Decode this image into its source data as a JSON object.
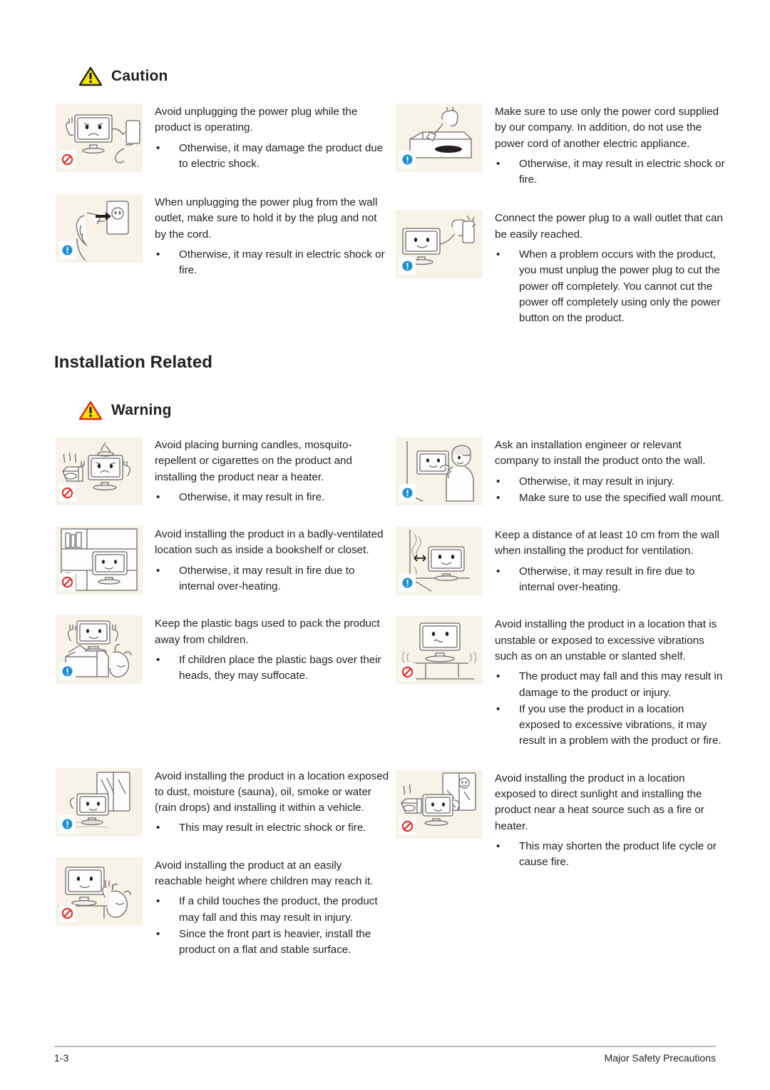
{
  "page": {
    "footer_page_number": "1-3",
    "footer_chapter": "Major Safety Precautions"
  },
  "colors": {
    "caution_triangle_fill": "#f7e400",
    "caution_triangle_stroke": "#231f20",
    "warning_triangle_fill": "#f7e400",
    "warning_triangle_stroke": "#e2231a",
    "prohibition_icon": "#e2231a",
    "info_icon": "#1b8fd1",
    "thumb_background": "#f7f3e8",
    "footer_rule": "#b9bec4",
    "text": "#231f20"
  },
  "sections": [
    {
      "id": "caution-section",
      "header": {
        "label": "Caution",
        "icon": "warning-triangle-icon"
      },
      "items_left": [
        {
          "illustration": "monitor-angry-unplugging-power-plug-illustration",
          "badge": "prohibition-icon",
          "lead": "Avoid unplugging the power plug while the product is operating.",
          "bullets": [
            "Otherwise, it may damage the product due to electric shock."
          ]
        },
        {
          "illustration": "hand-pulling-plug-from-wall-outlet-illustration",
          "badge": "info-icon",
          "lead": "When unplugging the power plug from the wall outlet, make sure to hold it by the plug and not by the cord.",
          "bullets": [
            "Otherwise, it may result in electric shock or fire."
          ]
        }
      ],
      "items_right": [
        {
          "illustration": "power-cord-in-samsung-box-illustration",
          "badge": "info-icon",
          "lead": "Make sure to use only the power cord supplied by our company. In addition, do not use the power cord of another electric appliance.",
          "bullets": [
            "Otherwise, it may result in electric shock or fire."
          ]
        },
        {
          "illustration": "monitor-plugged-into-wall-outlet-illustration",
          "badge": "info-icon",
          "lead": "Connect the power plug to a wall outlet that can be easily reached.",
          "bullets": [
            "When a problem occurs with the product, you must unplug the power plug to cut the power off completely. You cannot cut the power off completely using only the power button on the product."
          ]
        }
      ]
    },
    {
      "id": "installation-related-section",
      "title": "Installation Related",
      "header": {
        "label": "Warning",
        "icon": "warning-triangle-icon"
      },
      "items_left": [
        {
          "illustration": "monitor-near-candle-and-heater-illustration",
          "badge": "prohibition-icon",
          "lead": "Avoid placing burning candles,  mosquito-repellent or cigarettes on the product and installing the product near a heater.",
          "bullets": [
            "Otherwise, it may result in fire."
          ]
        },
        {
          "illustration": "monitor-inside-bookshelf-illustration",
          "badge": "prohibition-icon",
          "lead": "Avoid installing the product in a badly-ventilated location such as inside a bookshelf or closet.",
          "bullets": [
            "Otherwise, it may result in fire due to internal over-heating."
          ]
        },
        {
          "illustration": "child-with-plastic-bags-illustration",
          "badge": "info-icon",
          "lead": "Keep the plastic bags used to pack the product away from children.",
          "bullets": [
            " If children place the plastic bags over their heads, they may suffocate."
          ]
        },
        {
          "illustration": "monitor-exposed-to-rain-and-dust-illustration",
          "badge": "info-icon",
          "lead": "Avoid installing the product in a location exposed to dust, moisture (sauna), oil, smoke or water (rain drops) and installing it within a vehicle.",
          "bullets": [
            "This may result in electric shock or fire."
          ]
        },
        {
          "illustration": "child-reaching-for-monitor-illustration",
          "badge": "prohibition-icon",
          "lead": "Avoid installing the product at an easily reachable height where children may reach it.",
          "bullets": [
            "If a child touches the product, the product may fall and this may result in injury.",
            "Since the front part is heavier, install the product on a flat and stable surface."
          ]
        }
      ],
      "items_right": [
        {
          "illustration": "engineer-installing-monitor-on-wall-illustration",
          "badge": "info-icon",
          "lead": "Ask an installation engineer or relevant company to install the product onto the wall.",
          "bullets": [
            "Otherwise, it may result in injury.",
            "Make sure to use the specified wall mount."
          ]
        },
        {
          "illustration": "monitor-distance-from-wall-illustration",
          "badge": "info-icon",
          "lead": "Keep a distance of at least 10 cm from the wall when installing the product for ventilation.",
          "bullets": [
            "Otherwise, it may result in fire due to internal over-heating."
          ]
        },
        {
          "illustration": "monitor-on-unstable-shelf-illustration",
          "badge": "prohibition-icon",
          "lead": "Avoid installing the product in a location that is unstable or exposed to excessive vibrations such as on an unstable or slanted shelf.",
          "bullets": [
            "The product may fall and this may result in damage to the product or injury.",
            "If you use the product in a location exposed to excessive vibrations, it may result in a problem with the product or fire."
          ]
        },
        {
          "illustration": "monitor-in-direct-sunlight-near-heater-illustration",
          "badge": "prohibition-icon",
          "lead": "Avoid installing the product in a location exposed to direct sunlight and installing the product near a heat source such as a fire or heater.",
          "bullets": [
            "This may shorten the product life cycle or cause fire."
          ]
        }
      ]
    }
  ]
}
